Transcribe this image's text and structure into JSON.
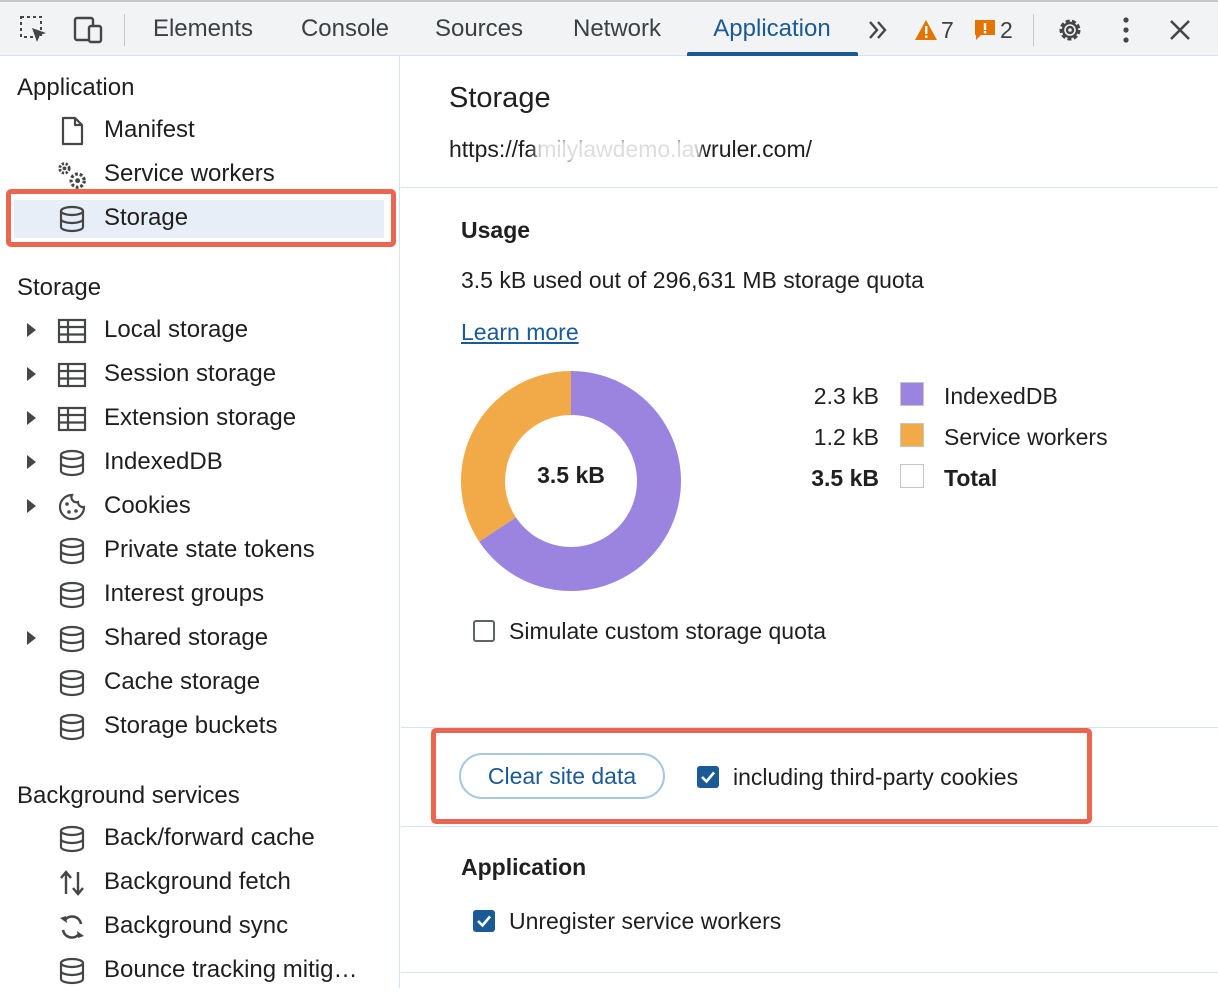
{
  "toolbar": {
    "tabs": [
      "Elements",
      "Console",
      "Sources",
      "Network",
      "Application"
    ],
    "active_tab": "Application",
    "more_label": "»",
    "warnings_count": "7",
    "issues_count": "2",
    "icons": [
      "inspect-element-icon",
      "device-toolbar-icon",
      "more-tabs-icon",
      "warning-icon",
      "issue-icon",
      "settings-icon",
      "kebab-menu-icon",
      "close-icon"
    ]
  },
  "sidebar": {
    "application": {
      "title": "Application",
      "items": [
        {
          "label": "Manifest",
          "icon": "document-icon"
        },
        {
          "label": "Service workers",
          "icon": "gears-icon"
        },
        {
          "label": "Storage",
          "icon": "database-icon",
          "selected": true
        }
      ]
    },
    "storage": {
      "title": "Storage",
      "items": [
        {
          "label": "Local storage",
          "icon": "table-icon",
          "expandable": true
        },
        {
          "label": "Session storage",
          "icon": "table-icon",
          "expandable": true
        },
        {
          "label": "Extension storage",
          "icon": "table-icon",
          "expandable": true
        },
        {
          "label": "IndexedDB",
          "icon": "database-icon",
          "expandable": true
        },
        {
          "label": "Cookies",
          "icon": "cookie-icon",
          "expandable": true
        },
        {
          "label": "Private state tokens",
          "icon": "database-icon",
          "expandable": false
        },
        {
          "label": "Interest groups",
          "icon": "database-icon",
          "expandable": false
        },
        {
          "label": "Shared storage",
          "icon": "database-icon",
          "expandable": true
        },
        {
          "label": "Cache storage",
          "icon": "database-icon",
          "expandable": false
        },
        {
          "label": "Storage buckets",
          "icon": "database-icon",
          "expandable": false
        }
      ]
    },
    "background": {
      "title": "Background services",
      "items": [
        {
          "label": "Back/forward cache",
          "icon": "database-icon"
        },
        {
          "label": "Background fetch",
          "icon": "up-down-arrows-icon"
        },
        {
          "label": "Background sync",
          "icon": "sync-icon"
        },
        {
          "label": "Bounce tracking mitig…",
          "icon": "database-icon"
        }
      ]
    }
  },
  "main": {
    "title": "Storage",
    "origin": "https://familylawdemo.lawruler.com/",
    "usage": {
      "heading": "Usage",
      "text": "3.5 kB used out of 296,631 MB storage quota",
      "learn_more": "Learn more",
      "total_center": "3.5 kB",
      "legend": [
        {
          "value": "2.3 kB",
          "name": "IndexedDB",
          "color": "#9a84e0"
        },
        {
          "value": "1.2 kB",
          "name": "Service workers",
          "color": "#f1aa47"
        },
        {
          "value": "3.5 kB",
          "name": "Total",
          "color": "#ffffff",
          "bold": true
        }
      ],
      "simulate_label": "Simulate custom storage quota",
      "simulate_checked": false
    },
    "clear": {
      "button_label": "Clear site data",
      "third_party_label": "including third-party cookies",
      "third_party_checked": true
    },
    "application": {
      "heading": "Application",
      "unregister_label": "Unregister service workers",
      "unregister_checked": true
    }
  },
  "colors": {
    "accent": "#1a5a96",
    "annotation": "#ea6650",
    "indexeddb": "#9a84e0",
    "service_workers": "#f1aa47"
  },
  "chart_data": {
    "type": "pie",
    "categories": [
      "IndexedDB",
      "Service workers"
    ],
    "values": [
      2.3,
      1.2
    ],
    "unit": "kB",
    "center_label": "3.5 kB"
  }
}
